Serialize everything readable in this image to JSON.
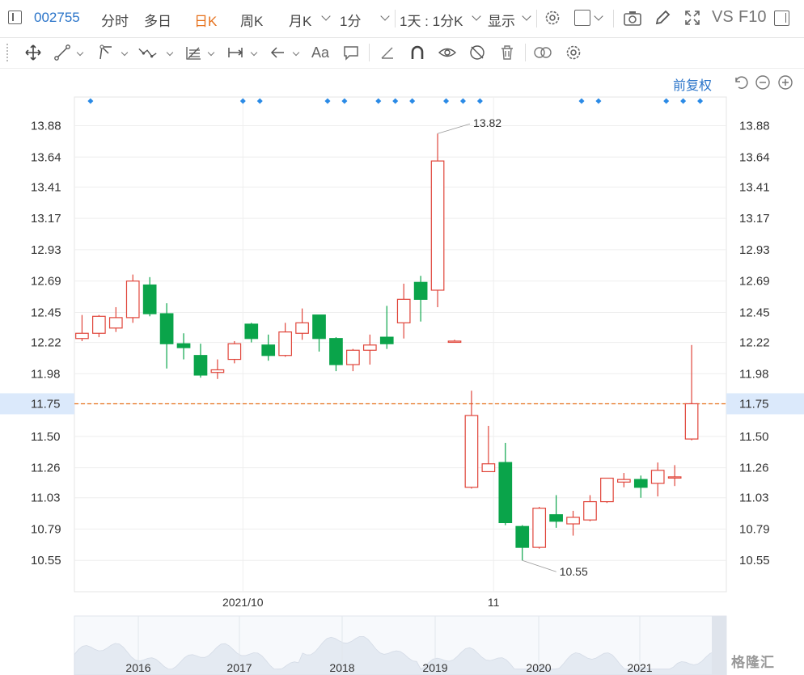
{
  "toolbar": {
    "code": "002755",
    "tabs": [
      "分时",
      "多日",
      "日K",
      "周K",
      "月K"
    ],
    "active_tab": "日K",
    "period": "1分",
    "range": "1天 : 1分K",
    "display_label": "显示",
    "vs_label": "VS",
    "f10_label": "F10"
  },
  "drawing_tools": [
    "move-icon",
    "line-icon",
    "polyline-icon",
    "wave-icon",
    "fib-icon",
    "measure-icon",
    "arrow-left-icon",
    "text-icon",
    "comment-icon",
    "pen-icon",
    "magnet-icon",
    "eye-icon",
    "hide-icon",
    "trash-icon",
    "link-icon",
    "settings-icon"
  ],
  "adjust_label": "前复权",
  "watermark": "格隆汇",
  "colors": {
    "up": "#e0453a",
    "down": "#0aa44a",
    "accent": "#2a74c9",
    "price_line": "#e6711c"
  },
  "chart_data": {
    "type": "candlestick",
    "y_ticks": [
      "13.88",
      "13.64",
      "13.41",
      "13.17",
      "12.93",
      "12.69",
      "12.45",
      "12.22",
      "11.98",
      "11.75",
      "11.50",
      "11.26",
      "11.03",
      "10.79",
      "10.55"
    ],
    "ylim": [
      10.31,
      14.1
    ],
    "current_price": "11.75",
    "date_labels": [
      "2021/10",
      "11"
    ],
    "high_label": "13.82",
    "low_label": "10.55",
    "candles": [
      {
        "o": 12.25,
        "h": 12.43,
        "l": 12.23,
        "c": 12.29
      },
      {
        "o": 12.29,
        "h": 12.43,
        "l": 12.26,
        "c": 12.42
      },
      {
        "o": 12.33,
        "h": 12.49,
        "l": 12.3,
        "c": 12.41
      },
      {
        "o": 12.41,
        "h": 12.74,
        "l": 12.37,
        "c": 12.69
      },
      {
        "o": 12.66,
        "h": 12.72,
        "l": 12.42,
        "c": 12.44
      },
      {
        "o": 12.44,
        "h": 12.52,
        "l": 12.02,
        "c": 12.21
      },
      {
        "o": 12.21,
        "h": 12.29,
        "l": 12.09,
        "c": 12.18
      },
      {
        "o": 12.12,
        "h": 12.21,
        "l": 11.95,
        "c": 11.97
      },
      {
        "o": 11.99,
        "h": 12.09,
        "l": 11.94,
        "c": 12.01
      },
      {
        "o": 12.09,
        "h": 12.23,
        "l": 12.06,
        "c": 12.21
      },
      {
        "o": 12.36,
        "h": 12.37,
        "l": 12.22,
        "c": 12.25
      },
      {
        "o": 12.2,
        "h": 12.28,
        "l": 12.08,
        "c": 12.12
      },
      {
        "o": 12.12,
        "h": 12.37,
        "l": 12.11,
        "c": 12.3
      },
      {
        "o": 12.29,
        "h": 12.48,
        "l": 12.24,
        "c": 12.37
      },
      {
        "o": 12.43,
        "h": 12.43,
        "l": 12.15,
        "c": 12.25
      },
      {
        "o": 12.25,
        "h": 12.26,
        "l": 12.0,
        "c": 12.05
      },
      {
        "o": 12.05,
        "h": 12.17,
        "l": 12.0,
        "c": 12.16
      },
      {
        "o": 12.16,
        "h": 12.28,
        "l": 12.05,
        "c": 12.2
      },
      {
        "o": 12.26,
        "h": 12.5,
        "l": 12.17,
        "c": 12.21
      },
      {
        "o": 12.37,
        "h": 12.67,
        "l": 12.25,
        "c": 12.55
      },
      {
        "o": 12.68,
        "h": 12.73,
        "l": 12.38,
        "c": 12.55
      },
      {
        "o": 12.62,
        "h": 13.82,
        "l": 12.49,
        "c": 13.61
      },
      {
        "o": 12.23,
        "h": 12.24,
        "l": 12.22,
        "c": 12.23
      },
      {
        "o": 11.11,
        "h": 11.85,
        "l": 11.1,
        "c": 11.66
      },
      {
        "o": 11.23,
        "h": 11.58,
        "l": 11.23,
        "c": 11.29
      },
      {
        "o": 11.3,
        "h": 11.45,
        "l": 10.82,
        "c": 10.84
      },
      {
        "o": 10.81,
        "h": 10.82,
        "l": 10.55,
        "c": 10.65
      },
      {
        "o": 10.65,
        "h": 10.96,
        "l": 10.64,
        "c": 10.95
      },
      {
        "o": 10.9,
        "h": 11.05,
        "l": 10.8,
        "c": 10.85
      },
      {
        "o": 10.83,
        "h": 10.93,
        "l": 10.74,
        "c": 10.88
      },
      {
        "o": 10.86,
        "h": 11.05,
        "l": 10.85,
        "c": 11.0
      },
      {
        "o": 11.0,
        "h": 11.18,
        "l": 10.99,
        "c": 11.18
      },
      {
        "o": 11.15,
        "h": 11.22,
        "l": 11.11,
        "c": 11.17
      },
      {
        "o": 11.17,
        "h": 11.2,
        "l": 11.03,
        "c": 11.11
      },
      {
        "o": 11.14,
        "h": 11.3,
        "l": 11.04,
        "c": 11.24
      },
      {
        "o": 11.19,
        "h": 11.28,
        "l": 11.12,
        "c": 11.19
      },
      {
        "o": 11.48,
        "h": 12.2,
        "l": 11.47,
        "c": 11.75
      }
    ],
    "markers_after": [
      0,
      9,
      10,
      14,
      15,
      17,
      18,
      19,
      21,
      22,
      23,
      29,
      30,
      34,
      35,
      36
    ],
    "overview_years": [
      "2016",
      "2017",
      "2018",
      "2019",
      "2020",
      "2021"
    ]
  }
}
